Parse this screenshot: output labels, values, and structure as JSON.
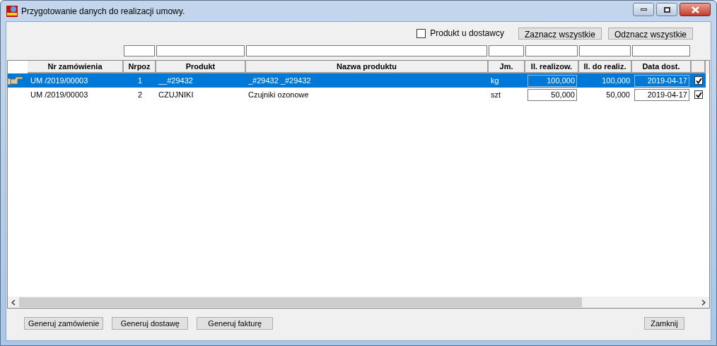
{
  "window": {
    "title": "Przygotowanie danych do realizacji umowy."
  },
  "supplier_filter": {
    "label": "Produkt u dostawcy",
    "checked": false
  },
  "top_buttons": [
    "Zaznacz wszystkie",
    "Odznacz wszystkie"
  ],
  "table": {
    "columns": [
      "Nr zamówienia",
      "Nrpoz",
      "Produkt",
      "Nazwa produktu",
      "Jm.",
      "Il. realizow.",
      "Il. do realiz.",
      "Data dost."
    ],
    "rows": [
      {
        "selected": true,
        "checked": true,
        "cells": [
          "UM  /2019/00003",
          "1",
          "__#29432",
          "_#29432 _#29432",
          "kg",
          "100,000",
          "100,000",
          "2019-04-17"
        ]
      },
      {
        "selected": false,
        "checked": true,
        "cells": [
          "UM  /2019/00003",
          "2",
          "CZUJNIKI",
          "Czujniki ozonowe",
          "szt",
          "50,000",
          "50,000",
          "2019-04-17"
        ]
      }
    ]
  },
  "bottom_buttons": [
    "Generuj zamówienie",
    "Generuj dostawę",
    "Generuj fakturę"
  ],
  "close_button": "Zamknij"
}
